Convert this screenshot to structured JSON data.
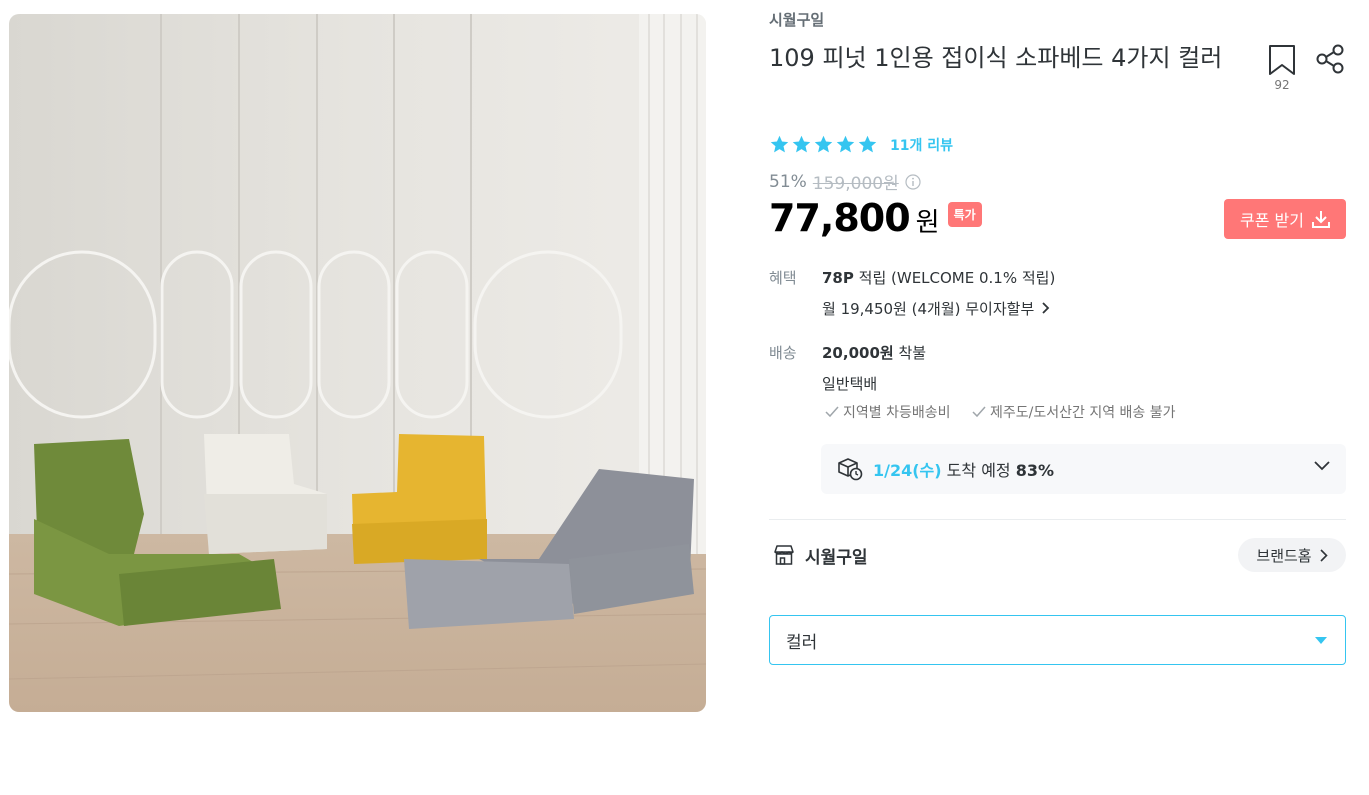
{
  "product": {
    "brand": "시월구일",
    "title": "109 피넛 1인용 접이식 소파베드 4가지 컬러",
    "bookmark_count": "92",
    "rating": {
      "stars": 5,
      "review_text": "11개 리뷰"
    },
    "discount_rate": "51%",
    "original_price": "159,000원",
    "price": "77,800",
    "price_unit": "원",
    "special_badge": "특가"
  },
  "coupon": {
    "label": "쿠폰 받기"
  },
  "benefit": {
    "label": "혜택",
    "points": "78P",
    "points_text": " 적립 (WELCOME 0.1% 적립)",
    "installment": "월 19,450원 (4개월) 무이자할부"
  },
  "shipping": {
    "label": "배송",
    "fee": "20,000원",
    "fee_suffix": " 착불",
    "method": "일반택배",
    "notes": [
      "지역별 차등배송비",
      "제주도/도서산간 지역 배송 불가"
    ],
    "eta_date": "1/24(수)",
    "eta_text": " 도착 예정 ",
    "eta_percent": "83%"
  },
  "brand_row": {
    "name": "시월구일",
    "home_label": "브랜드홈"
  },
  "option": {
    "placeholder": "컬러"
  },
  "colors": {
    "accent": "#35c5f0",
    "coupon": "#ff7777",
    "text": "#2f3438",
    "muted": "#828c94"
  },
  "icons": [
    "bookmark-icon",
    "share-icon",
    "star-icon",
    "info-icon",
    "download-icon",
    "chevron-right-icon",
    "check-icon",
    "delivery-box-icon",
    "chevron-down-icon",
    "store-icon",
    "caret-down-icon"
  ]
}
